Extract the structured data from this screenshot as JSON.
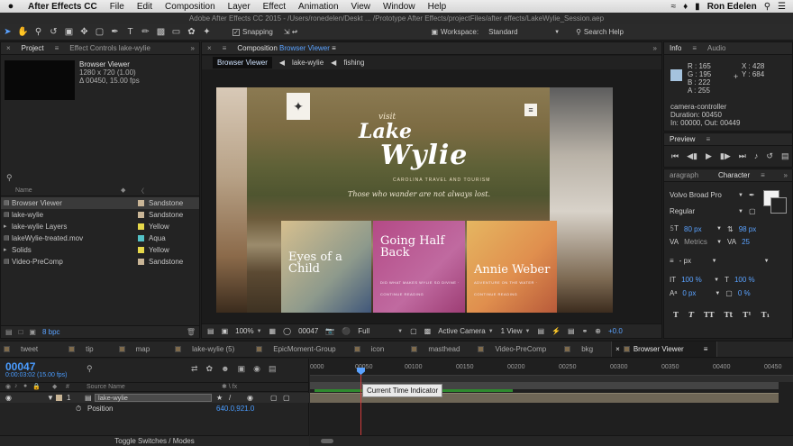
{
  "menubar": {
    "items": [
      "After Effects CC",
      "File",
      "Edit",
      "Composition",
      "Layer",
      "Effect",
      "Animation",
      "View",
      "Window",
      "Help"
    ],
    "user": "Ron Edelen"
  },
  "window_title": "Adobe After Effects CC 2015 - /Users/ronedelen/Deskt ... /Prototype After Effects/projectFiles/after effects/LakeWylie_Session.aep",
  "toolbar": {
    "snapping_label": "Snapping",
    "workspace_label": "Workspace:",
    "workspace_value": "Standard",
    "search_placeholder": "Search Help"
  },
  "project": {
    "tab_project": "Project",
    "tab_effects": "Effect Controls lake-wylie",
    "selected_name": "Browser Viewer",
    "selected_dims": "1280 x 720 (1.00)",
    "selected_dur": "Δ 00450, 15.00 fps",
    "col_name": "Name",
    "items": [
      {
        "name": "Browser Viewer",
        "label": "Sandstone",
        "color": "#c9b596",
        "icon": "▤"
      },
      {
        "name": "lake-wylie",
        "label": "Sandstone",
        "color": "#c9b596",
        "icon": "▤"
      },
      {
        "name": "lake-wylie Layers",
        "label": "Yellow",
        "color": "#e6d84a",
        "icon": "▸"
      },
      {
        "name": "lakeWylie-treated.mov",
        "label": "Aqua",
        "color": "#53c2c7",
        "icon": "▤"
      },
      {
        "name": "Solids",
        "label": "Yellow",
        "color": "#e6d84a",
        "icon": "▸"
      },
      {
        "name": "Video-PreComp",
        "label": "Sandstone",
        "color": "#c9b596",
        "icon": "▤"
      }
    ],
    "bpc": "8 bpc"
  },
  "comp": {
    "tab_prefix": "Composition",
    "tab_name": "Browser Viewer",
    "crumbs": [
      "Browser Viewer",
      "lake-wylie",
      "fishing"
    ],
    "site": {
      "visit": "visit",
      "title1": "Lake",
      "title2": "Wylie",
      "sub": "CAROLINA TRAVEL AND TOURISM",
      "tagline": "Those who wander are not always lost.",
      "cards": [
        {
          "title": "Eyes of a Child",
          "small": ""
        },
        {
          "title": "Going Half Back",
          "small": "DID WHAT MAKES WYLIE SO DIVINE · CONTINUE READING"
        },
        {
          "title": "Annie Weber",
          "small": "ADVENTURE ON THE WATER · CONTINUE READING"
        }
      ]
    },
    "footer": {
      "zoom": "100%",
      "frame": "00047",
      "resolution": "Full",
      "camera": "Active Camera",
      "views": "1 View",
      "exposure": "+0.0"
    }
  },
  "info": {
    "tab_info": "Info",
    "tab_audio": "Audio",
    "rgba": [
      "R : 165",
      "G : 195",
      "B : 222",
      "A : 255"
    ],
    "xy": [
      "X : 428",
      "Y : 684"
    ],
    "swatch_color": "#a5c3de",
    "layer_lines": [
      "camera-controller",
      "Duration: 00450",
      "In: 00000, Out: 00449"
    ]
  },
  "preview": {
    "tab": "Preview"
  },
  "character": {
    "tab_para": "aragraph",
    "tab_char": "Character",
    "font": "Volvo Broad Pro",
    "style": "Regular",
    "size": "80 px",
    "leading": "98 px",
    "kerning": "Metrics",
    "tracking": "25",
    "stroke": "- px",
    "vscale": "100 %",
    "hscale": "100 %",
    "baseline": "0 px",
    "tsume": "0 %",
    "styles": [
      "T",
      "T",
      "TT",
      "Tt",
      "T¹",
      "T₁"
    ]
  },
  "layer_tabs": [
    "tweet",
    "tip",
    "map",
    "lake-wylie (5)",
    "EpicMoment-Group",
    "icon",
    "masthead",
    "Video-PreComp",
    "bkg",
    "Browser Viewer"
  ],
  "timeline": {
    "timecode": "00047",
    "timecode_sub": "0:00:03:02 (15.00 fps)",
    "col_num": "#",
    "col_source": "Source Name",
    "layer_num": "1",
    "layer_name": "lake-wylie",
    "prop_name": "Position",
    "prop_value": "640.0,921.0",
    "footer": "Toggle Switches / Modes",
    "ruler": [
      "0000",
      "00050",
      "00100",
      "00150",
      "00200",
      "00250",
      "00300",
      "00350",
      "00400",
      "00450"
    ],
    "tooltip": "Current Time Indicator"
  }
}
